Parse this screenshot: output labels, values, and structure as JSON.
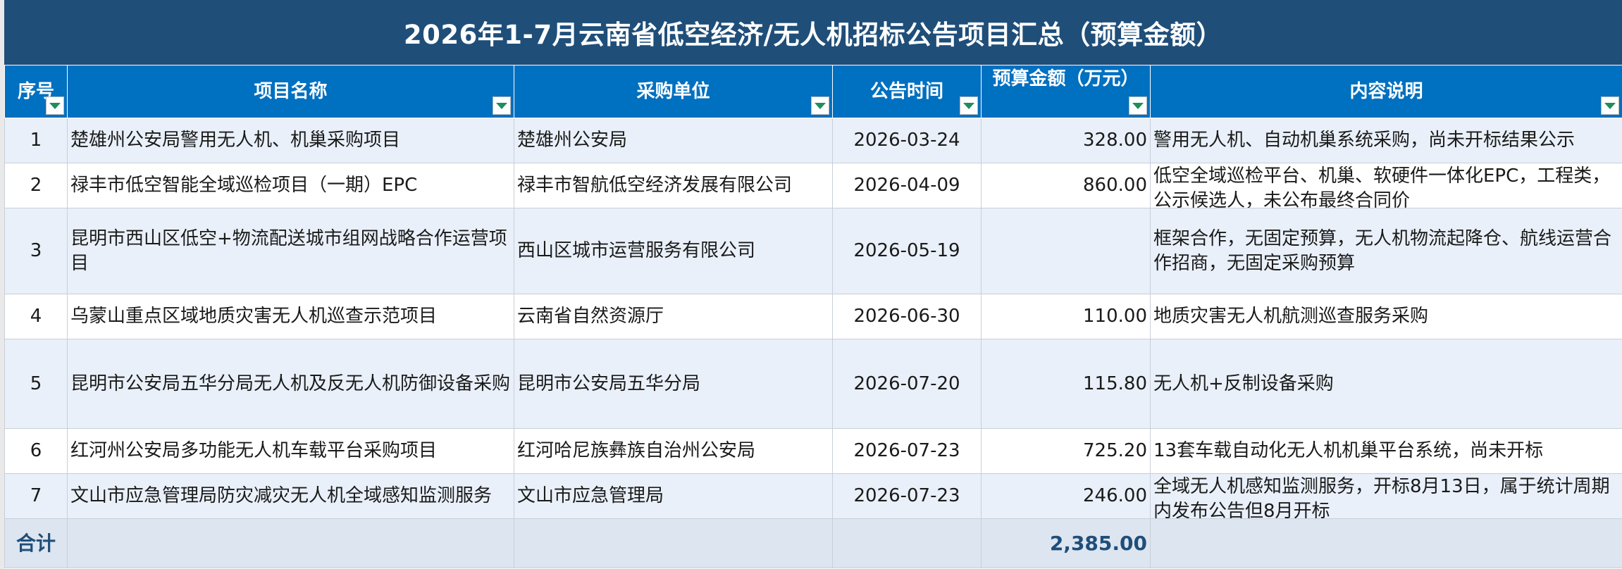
{
  "title": "2026年1-7月云南省低空经济/无人机招标公告项目汇总（预算金额）",
  "headers": [
    "序号",
    "项目名称",
    "采购单位",
    "公告时间",
    "预算金额（万元）",
    "内容说明"
  ],
  "rows": [
    {
      "no": "1",
      "name": "楚雄州公安局警用无人机、机巢采购项目",
      "buyer": "楚雄州公安局",
      "date": "2026-03-24",
      "budget": "328.00",
      "desc": "警用无人机、自动机巢系统采购，尚未开标结果公示"
    },
    {
      "no": "2",
      "name": "禄丰市低空智能全域巡检项目（一期）EPC",
      "buyer": "禄丰市智航低空经济发展有限公司",
      "date": "2026-04-09",
      "budget": "860.00",
      "desc": "低空全域巡检平台、机巢、软硬件一体化EPC，工程类，公示候选人，未公布最终合同价"
    },
    {
      "no": "3",
      "name": "昆明市西山区低空+物流配送城市组网战略合作运营项目",
      "buyer": "西山区城市运营服务有限公司",
      "date": "2026-05-19",
      "budget": "",
      "desc": "框架合作，无固定预算，无人机物流起降仓、航线运营合作招商，无固定采购预算"
    },
    {
      "no": "4",
      "name": "乌蒙山重点区域地质灾害无人机巡查示范项目",
      "buyer": "云南省自然资源厅",
      "date": "2026-06-30",
      "budget": "110.00",
      "desc": "地质灾害无人机航测巡查服务采购"
    },
    {
      "no": "5",
      "name": "昆明市公安局五华分局无人机及反无人机防御设备采购",
      "buyer": "昆明市公安局五华分局",
      "date": "2026-07-20",
      "budget": "115.80",
      "desc": "无人机+反制设备采购"
    },
    {
      "no": "6",
      "name": "红河州公安局多功能无人机车载平台采购项目",
      "buyer": "红河哈尼族彝族自治州公安局",
      "date": "2026-07-23",
      "budget": "725.20",
      "desc": "13套车载自动化无人机机巢平台系统，尚未开标"
    },
    {
      "no": "7",
      "name": "文山市应急管理局防灾减灾无人机全域感知监测服务",
      "buyer": "文山市应急管理局",
      "date": "2026-07-23",
      "budget": "246.00",
      "desc": "全域无人机感知监测服务，开标8月13日，属于统计周期内发布公告但8月开标"
    }
  ],
  "total": {
    "label": "合计",
    "value": "2,385.00"
  },
  "icons": {
    "filter": "filter-dropdown-icon"
  },
  "colors": {
    "title_bg": "#1f4e79",
    "header_bg": "#0070c0",
    "band": "#e9f0f9",
    "total_bg": "#dde5f0",
    "filter_arrow": "#1e8e5a"
  }
}
